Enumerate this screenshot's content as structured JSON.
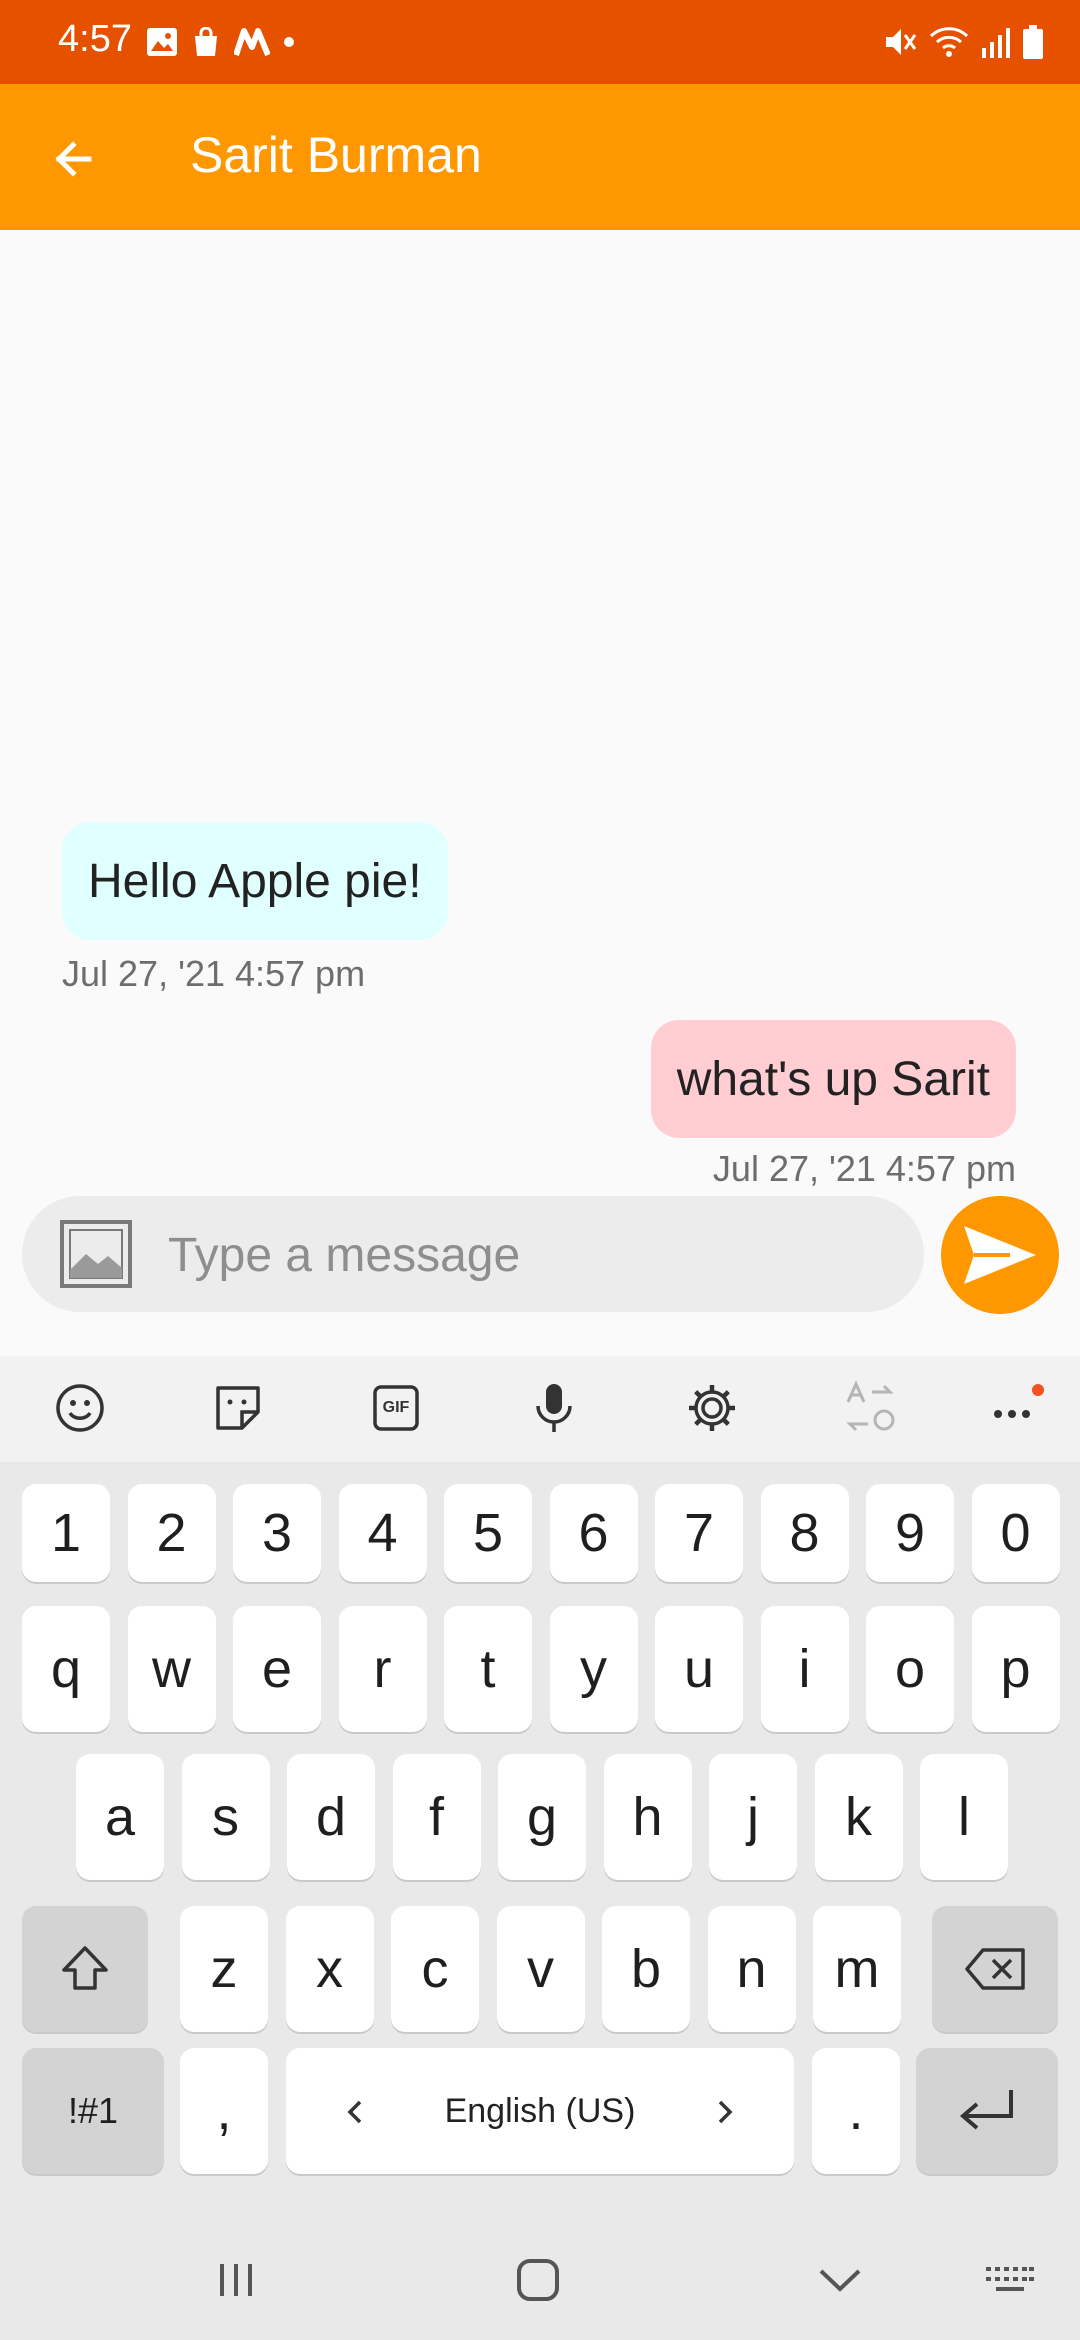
{
  "status_bar": {
    "time": "4:57",
    "left_icons": [
      "image-icon",
      "shopping-bag-icon",
      "m-app-icon",
      "notification-dot"
    ],
    "right_icons": [
      "mute-icon",
      "wifi-icon",
      "signal-icon",
      "battery-icon"
    ]
  },
  "app_bar": {
    "title": "Sarit Burman",
    "back_icon": "arrow-left-icon",
    "color": "#FF9800",
    "status_color": "#E65100"
  },
  "messages": [
    {
      "direction": "incoming",
      "text": "Hello Apple pie!",
      "timestamp": "Jul 27, '21 4:57 pm",
      "bubble_color": "#E0FFFF"
    },
    {
      "direction": "outgoing",
      "text": "what's up Sarit",
      "timestamp": "Jul 27, '21 4:57 pm",
      "bubble_color": "#FFCDD2"
    }
  ],
  "composer": {
    "placeholder": "Type a message",
    "value": "",
    "attach_icon": "image-icon",
    "send_icon": "send-icon"
  },
  "keyboard": {
    "toolbar": [
      "emoji-icon",
      "sticker-icon",
      "gif-icon",
      "microphone-icon",
      "settings-icon",
      "translate-icon",
      "more-icon"
    ],
    "gif_label": "GIF",
    "row_numbers": [
      "1",
      "2",
      "3",
      "4",
      "5",
      "6",
      "7",
      "8",
      "9",
      "0"
    ],
    "row_1": [
      "q",
      "w",
      "e",
      "r",
      "t",
      "y",
      "u",
      "i",
      "o",
      "p"
    ],
    "row_2": [
      "a",
      "s",
      "d",
      "f",
      "g",
      "h",
      "j",
      "k",
      "l"
    ],
    "row_3": [
      "z",
      "x",
      "c",
      "v",
      "b",
      "n",
      "m"
    ],
    "symbols_label": "!#1",
    "comma_label": ",",
    "space_label": "English (US)",
    "period_label": ".",
    "enter_icon": "enter-icon",
    "shift_icon": "shift-icon",
    "backspace_icon": "backspace-icon"
  },
  "nav_bar": [
    "recent-apps-icon",
    "home-icon",
    "hide-keyboard-icon",
    "keyboard-switch-icon"
  ]
}
